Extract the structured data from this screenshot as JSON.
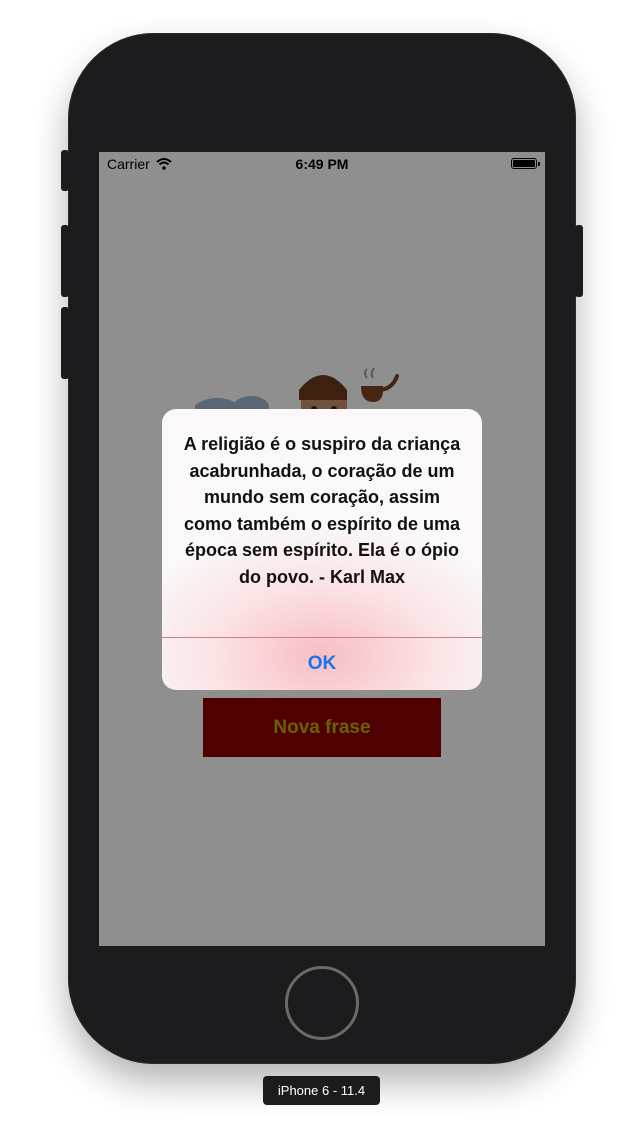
{
  "status_bar": {
    "carrier": "Carrier",
    "time": "6:49 PM",
    "wifi_icon": "wifi-icon",
    "battery_icon": "battery-icon"
  },
  "main": {
    "illustration": "philosopher-with-pipe-illustration",
    "new_quote_button": "Nova frase"
  },
  "alert": {
    "message": "A religião é o suspiro da criança acabrunhada, o coração de um mundo sem coração, assim como também o espírito de uma época sem espírito. Ela é o ópio do povo. - Karl Max",
    "ok_button": "OK"
  },
  "simulator": {
    "device_label": "iPhone 6 - 11.4"
  },
  "colors": {
    "button_background": "#8f0000",
    "button_text": "#b7b100",
    "alert_action": "#1a73e8",
    "device_frame": "#1c1c1e"
  }
}
